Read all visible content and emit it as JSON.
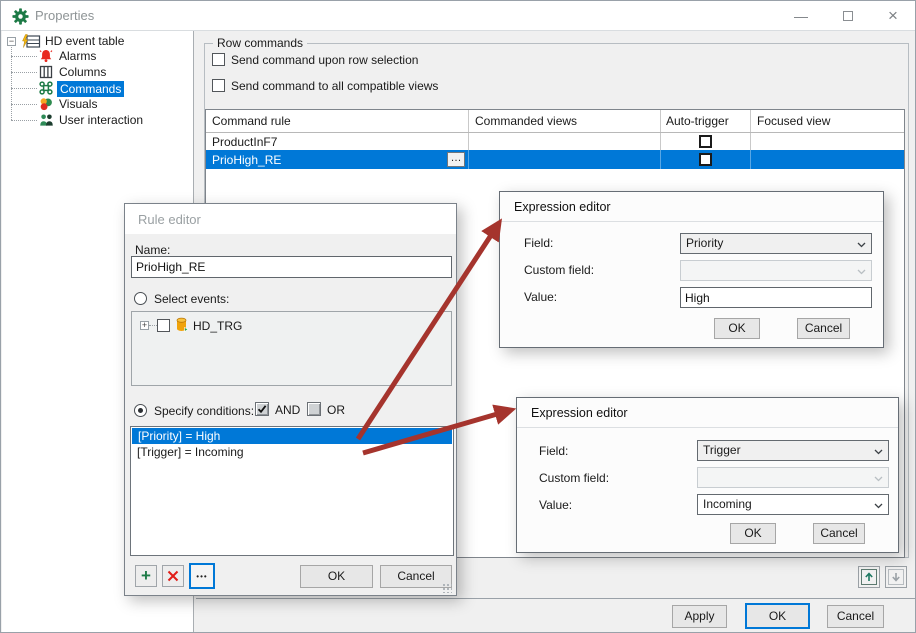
{
  "window": {
    "title": "Properties",
    "minimize_glyph": "—",
    "close_glyph": "×"
  },
  "tree": {
    "root_label": "HD event table",
    "root_expander": "−",
    "items": [
      {
        "label": "Alarms"
      },
      {
        "label": "Columns"
      },
      {
        "label": "Commands"
      },
      {
        "label": "Visuals"
      },
      {
        "label": "User interaction"
      }
    ]
  },
  "row_commands": {
    "title": "Row commands",
    "send_on_selection_label": "Send command upon row selection",
    "send_all_views_label": "Send command to all compatible views"
  },
  "table": {
    "columns": [
      {
        "label": "Command rule"
      },
      {
        "label": "Commanded views"
      },
      {
        "label": "Auto-trigger"
      },
      {
        "label": "Focused view"
      }
    ],
    "rows": [
      {
        "command_rule": "ProductInF7"
      },
      {
        "command_rule": "PrioHigh_RE"
      }
    ],
    "ellipsis_glyph": "…"
  },
  "rule_editor": {
    "title": "Rule editor",
    "name_label": "Name:",
    "name_value": "PrioHigh_RE",
    "select_events_label": "Select events:",
    "event_expander": "+",
    "event_item_label": "HD_TRG",
    "specify_conditions_label": "Specify conditions:",
    "and_label": "AND",
    "or_label": "OR",
    "conditions": [
      {
        "text": "[Priority] = High"
      },
      {
        "text": "[Trigger] = Incoming"
      }
    ],
    "add_glyph": "+",
    "more_glyph": "•••",
    "ok_label": "OK",
    "cancel_label": "Cancel"
  },
  "expression_editor_priority": {
    "title": "Expression editor",
    "field_label": "Field:",
    "field_value": "Priority",
    "custom_field_label": "Custom field:",
    "custom_field_value": "",
    "value_label": "Value:",
    "value_text": "High",
    "ok_label": "OK",
    "cancel_label": "Cancel"
  },
  "expression_editor_trigger": {
    "title": "Expression editor",
    "field_label": "Field:",
    "field_value": "Trigger",
    "custom_field_label": "Custom field:",
    "custom_field_value": "",
    "value_label": "Value:",
    "value_value": "Incoming",
    "ok_label": "OK",
    "cancel_label": "Cancel"
  },
  "footer": {
    "apply_label": "Apply",
    "ok_label": "OK",
    "cancel_label": "Cancel"
  },
  "colors": {
    "selection_blue": "#0078d7",
    "arrow_red": "#a5342d",
    "icon_green": "#1d7a46"
  }
}
